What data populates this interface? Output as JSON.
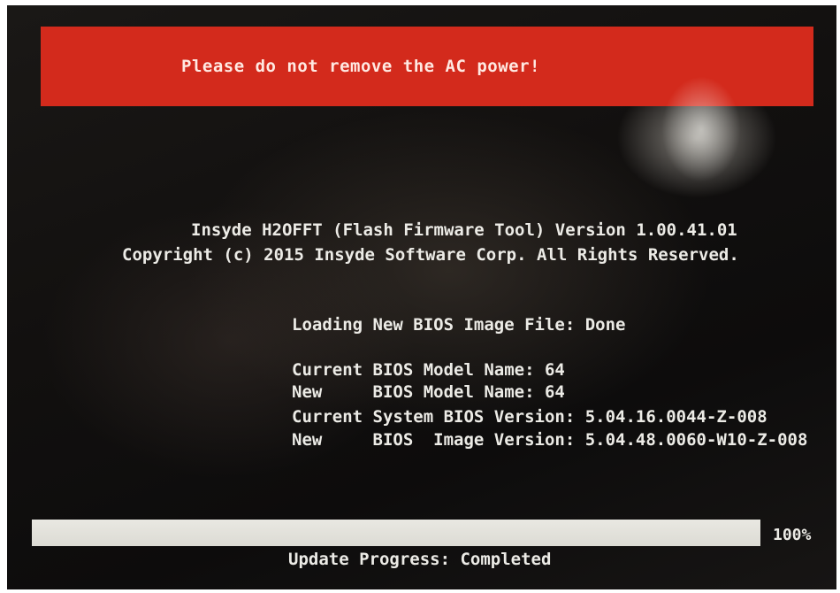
{
  "warning_banner": {
    "text": "Please do not remove the AC power!",
    "color": "#d32a1c"
  },
  "tool": {
    "version_line": "Insyde H2OFFT (Flash Firmware Tool) Version 1.00.41.01",
    "copyright_line": "Copyright (c) 2015 Insyde Software Corp. All Rights Reserved."
  },
  "bios_info": {
    "loading_line": "Loading New BIOS Image File: Done",
    "current_model_line": "Current BIOS Model Name: 64",
    "new_model_line": "New     BIOS Model Name: 64",
    "current_version_line": "Current System BIOS Version: 5.04.16.0044-Z-008",
    "new_version_line": "New     BIOS  Image Version: 5.04.48.0060-W10-Z-008"
  },
  "progress": {
    "percent_label": "100%",
    "fraction": 1.0,
    "status_line": "Update Progress: Completed"
  }
}
